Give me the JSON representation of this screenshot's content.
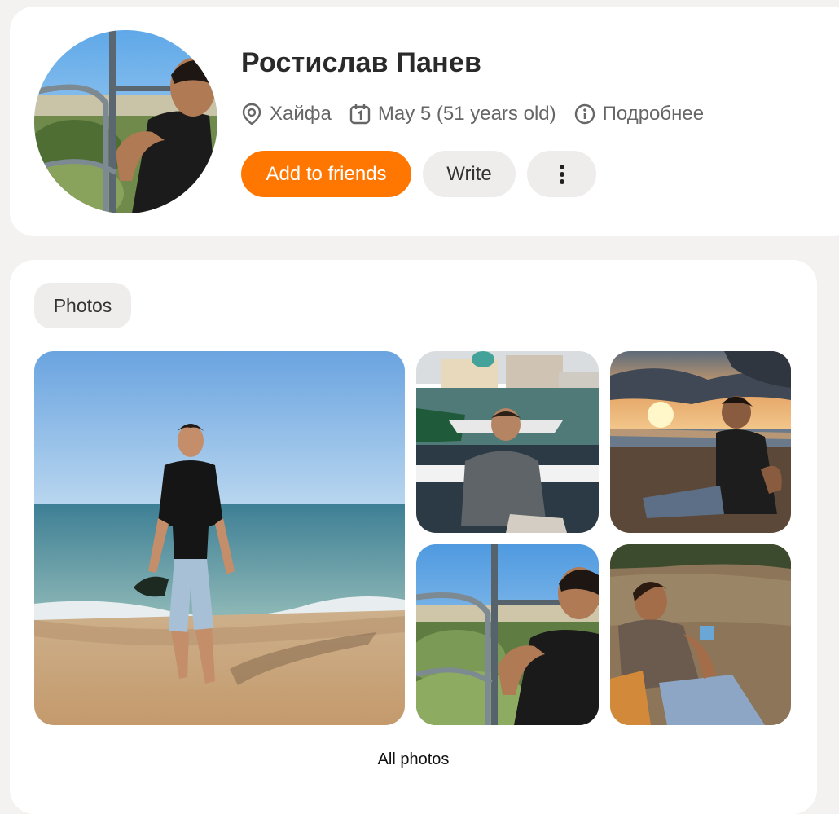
{
  "profile": {
    "name": "Ростислав Панев",
    "location": "Хайфа",
    "birthday": "May 5 (51 years old)",
    "more_info": "Подробнее",
    "actions": {
      "add_friend": "Add to friends",
      "write": "Write"
    },
    "accent_color": "#ff7700"
  },
  "photos": {
    "tab_label": "Photos",
    "all_photos_label": "All photos",
    "items": [
      "man standing on beach holding sandals",
      "man sitting by harbor with boats",
      "man sitting on beach at sunset",
      "man leaning on railing",
      "man sitting outdoors on dirt ground"
    ]
  },
  "icons": {
    "location": "location-pin-icon",
    "birthday": "calendar-icon",
    "info": "info-icon",
    "more": "more-vertical-icon"
  }
}
